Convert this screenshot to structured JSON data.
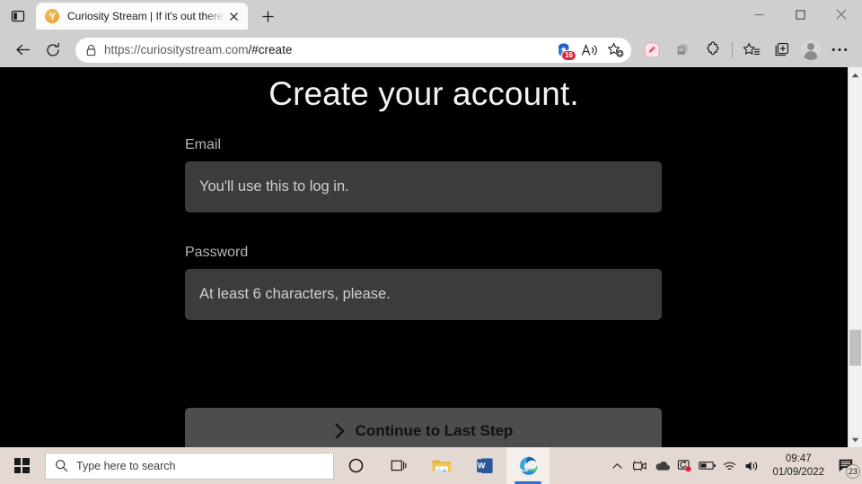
{
  "browser": {
    "tab": {
      "title": "Curiosity Stream | If it's out there",
      "favicon_name": "curiositystream-favicon",
      "close_label": "×"
    },
    "newtab_label": "+",
    "tab_search_name": "tab-search-icon",
    "window_controls": {
      "minimize": "—",
      "maximize": "□",
      "close": "×"
    },
    "toolbar": {
      "back_name": "back-arrow-icon",
      "refresh_name": "refresh-icon",
      "lock_name": "lock-icon",
      "url_prefix": "https://curiositystream.com",
      "url_suffix": "/#create",
      "url_full": "https://curiositystream.com/#create",
      "shopping_badge": "16",
      "shopping_name": "shopping-coupon-icon",
      "read_aloud_name": "read-aloud-icon",
      "add_favorite_name": "add-to-favorites-icon",
      "ext_pink_name": "extension-pink-icon",
      "ext_gray_name": "extension-collections-gray-icon",
      "extensions_name": "extensions-puzzle-icon",
      "favorites_name": "favorites-list-icon",
      "collections_name": "collections-icon",
      "profile_name": "profile-avatar-icon",
      "settings_name": "settings-and-more-icon"
    }
  },
  "page": {
    "title": "Create your account.",
    "email": {
      "label": "Email",
      "value": "",
      "placeholder": "You'll use this to log in."
    },
    "password": {
      "label": "Password",
      "value": "",
      "placeholder": "At least 6 characters, please."
    },
    "cta": {
      "label": "Continue to Last Step",
      "icon_name": "chevron-right-icon"
    },
    "colors": {
      "background": "#000000",
      "input_bg": "#3c3c3c",
      "cta_bg": "#4d4d4d",
      "title_text": "#f2f2f2",
      "label_text": "#b6b6b6"
    }
  },
  "scrollbar": {
    "up_name": "scroll-up-arrow",
    "down_name": "scroll-down-arrow",
    "thumb_name": "scroll-thumb"
  },
  "taskbar": {
    "start_name": "windows-start-icon",
    "search_placeholder": "Type here to search",
    "search_icon_name": "search-icon",
    "items": [
      {
        "name": "cortana-icon",
        "label": ""
      },
      {
        "name": "task-view-icon",
        "label": ""
      },
      {
        "name": "file-explorer-icon",
        "label": ""
      },
      {
        "name": "word-icon",
        "label": "W"
      },
      {
        "name": "microsoft-edge-icon",
        "label": ""
      }
    ],
    "tray": [
      {
        "name": "show-hidden-icons-chevron"
      },
      {
        "name": "camera-tray-icon"
      },
      {
        "name": "onedrive-icon"
      },
      {
        "name": "screen-snip-alert-icon"
      },
      {
        "name": "battery-icon"
      },
      {
        "name": "wifi-icon"
      },
      {
        "name": "volume-icon"
      }
    ],
    "clock": {
      "time": "09:47",
      "date": "01/09/2022"
    },
    "notifications": {
      "name": "action-center-icon",
      "count": "23"
    }
  }
}
